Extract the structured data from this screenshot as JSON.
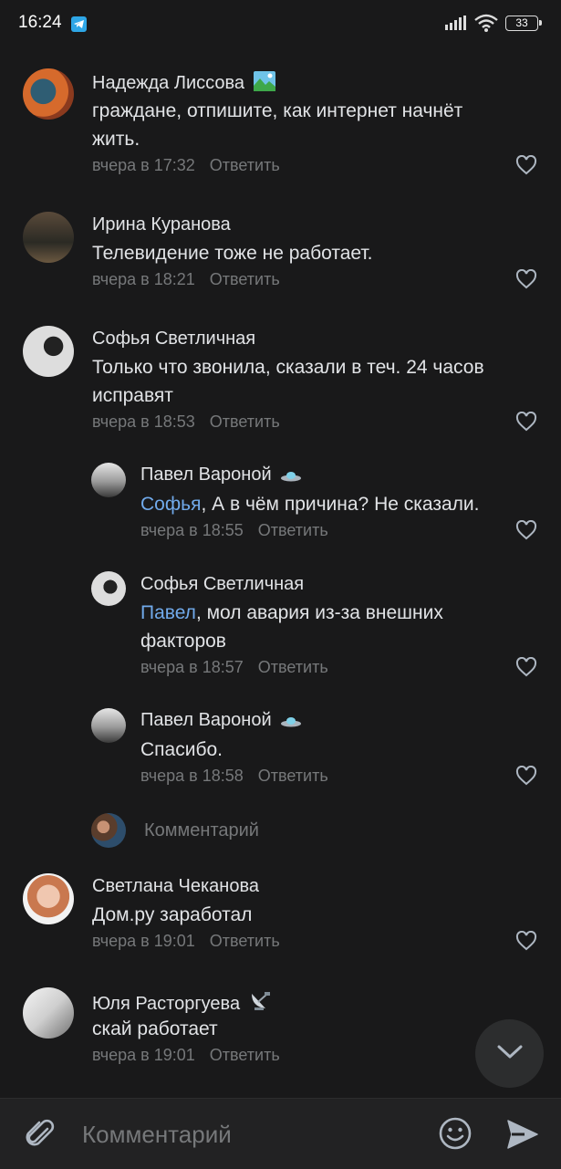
{
  "status_bar": {
    "time": "16:24",
    "battery": "33"
  },
  "comments": [
    {
      "author": "Надежда Лиссова",
      "text_parts": [
        "граждане, отпишите, как интернет начнёт",
        "жить."
      ],
      "time": "вчера в 17:32",
      "reply": "Ответить"
    },
    {
      "author": "Ирина Куранова",
      "text_parts": [
        "Телевидение тоже не работает."
      ],
      "time": "вчера в 18:21",
      "reply": "Ответить"
    },
    {
      "author": "Софья Светличная",
      "text_parts": [
        "Только что звонила, сказали в теч. 24 часов",
        "исправят"
      ],
      "time": "вчера в 18:53",
      "reply": "Ответить"
    }
  ],
  "replies": [
    {
      "author": "Павел Вароной",
      "mention": "Софья",
      "text": ", А в чём причина? Не сказали.",
      "time": "вчера в 18:55",
      "reply": "Ответить"
    },
    {
      "author": "Софья Светличная",
      "mention": "Павел",
      "text": ", мол авария из-за внешних",
      "text2": "факторов",
      "time": "вчера в 18:57",
      "reply": "Ответить"
    },
    {
      "author": "Павел Вароной",
      "text": "Спасибо.",
      "time": "вчера в 18:58",
      "reply": "Ответить"
    }
  ],
  "reply_prompt": "Комментарий",
  "comments2": [
    {
      "author": "Светлана Чеканова",
      "text": "Дом.ру заработал",
      "time": "вчера в 19:01",
      "reply": "Ответить"
    },
    {
      "author": "Юля Расторгуева",
      "text": "скай работает",
      "time": "вчера в 19:01",
      "reply": "Ответить"
    }
  ],
  "composer": {
    "placeholder": "Комментарий"
  },
  "colors": {
    "background": "#19191a",
    "link": "#71aaeb",
    "secondary_text": "#76787a"
  },
  "icons": [
    "telegram-icon",
    "signal-icon",
    "wifi-icon",
    "battery-icon",
    "heart-icon",
    "scroll-down-icon",
    "attach-icon",
    "smile-icon",
    "send-icon"
  ]
}
